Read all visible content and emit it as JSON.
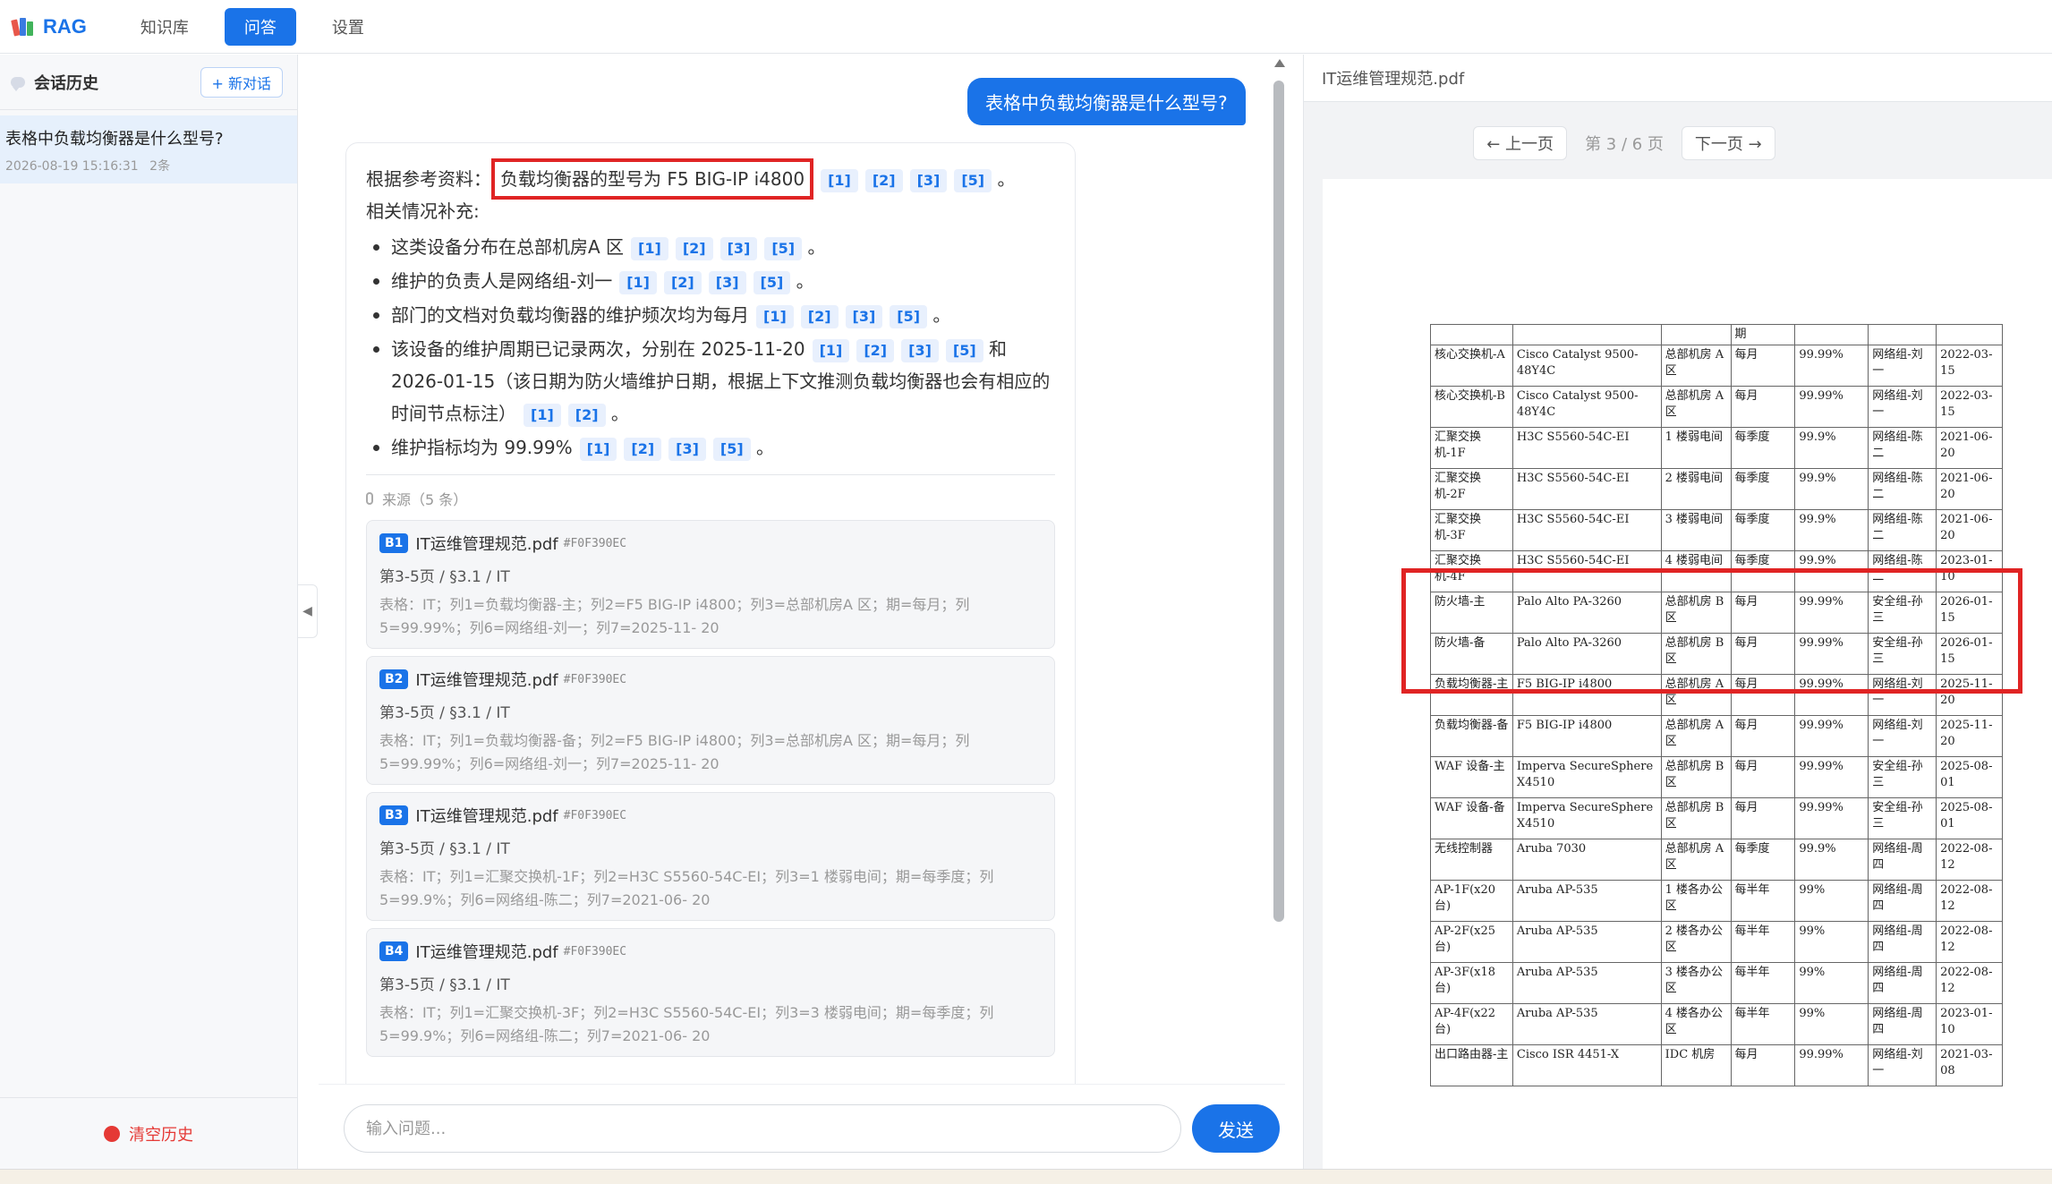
{
  "app": {
    "logo_text": "RAG",
    "nav": [
      {
        "label": "知识库",
        "active": false
      },
      {
        "label": "问答",
        "active": true
      },
      {
        "label": "设置",
        "active": false
      }
    ],
    "accent_color": "#1a73e8"
  },
  "sidebar": {
    "title": "会话历史",
    "new_chat_label": "+ 新对话",
    "sessions": [
      {
        "title": "表格中负载均衡器是什么型号?",
        "time": "2026-08-19 15:16:31",
        "count": "2条"
      }
    ],
    "clear_label": "清空历史"
  },
  "chat": {
    "user_question": "表格中负载均衡器是什么型号?",
    "answer": {
      "intro_prefix": "根据参考资料：",
      "intro_highlight": "负载均衡器的型号为 F5 BIG-IP i4800",
      "intro_cites": [
        "[1]",
        "[2]",
        "[3]",
        "[5]"
      ],
      "intro_suffix": "。",
      "supplement_label": "相关情况补充:",
      "bullets": [
        {
          "text": "这类设备分布在总部机房A 区",
          "cites": [
            "[1]",
            "[2]",
            "[3]",
            "[5]"
          ],
          "suffix": "。"
        },
        {
          "text": "维护的负责人是网络组-刘一",
          "cites": [
            "[1]",
            "[2]",
            "[3]",
            "[5]"
          ],
          "suffix": "。"
        },
        {
          "text": "部门的文档对负载均衡器的维护频次均为每月",
          "cites": [
            "[1]",
            "[2]",
            "[3]",
            "[5]"
          ],
          "suffix": "。"
        },
        {
          "text": "该设备的维护周期已记录两次，分别在 2025-11-20",
          "cites": [
            "[1]",
            "[2]",
            "[3]",
            "[5]"
          ],
          "suffix": "和 2026-01-15（该日期为防火墙维护日期，根据上下文推测负载均衡器也会有相应的时间节点标注）",
          "cites2": [
            "[1]",
            "[2]"
          ],
          "suffix2": "。"
        },
        {
          "text": "维护指标均为 99.99%",
          "cites": [
            "[1]",
            "[2]",
            "[3]",
            "[5]"
          ],
          "suffix": "。"
        }
      ]
    },
    "sources_label": "来源（5 条）",
    "sources": [
      {
        "badge": "B1",
        "file": "IT运维管理规范.pdf",
        "hash": "#F0F390EC",
        "loc": "第3-5页 / §3.1 / IT",
        "text": "表格：IT；列1=负载均衡器-主；列2=F5 BIG-IP i4800；列3=总部机房A 区；期=每月；列5=99.99%；列6=网络组-刘一；列7=2025-11- 20"
      },
      {
        "badge": "B2",
        "file": "IT运维管理规范.pdf",
        "hash": "#F0F390EC",
        "loc": "第3-5页 / §3.1 / IT",
        "text": "表格：IT；列1=负载均衡器-备；列2=F5 BIG-IP i4800；列3=总部机房A 区；期=每月；列5=99.99%；列6=网络组-刘一；列7=2025-11- 20"
      },
      {
        "badge": "B3",
        "file": "IT运维管理规范.pdf",
        "hash": "#F0F390EC",
        "loc": "第3-5页 / §3.1 / IT",
        "text": "表格：IT；列1=汇聚交换机-1F；列2=H3C S5560-54C-EI；列3=1 楼弱电间；期=每季度；列5=99.9%；列6=网络组-陈二；列7=2021-06- 20"
      },
      {
        "badge": "B4",
        "file": "IT运维管理规范.pdf",
        "hash": "#F0F390EC",
        "loc": "第3-5页 / §3.1 / IT",
        "text": "表格：IT；列1=汇聚交换机-3F；列2=H3C S5560-54C-EI；列3=3 楼弱电间；期=每季度；列5=99.9%；列6=网络组-陈二；列7=2021-06- 20"
      }
    ],
    "input_placeholder": "输入问题...",
    "send_label": "发送"
  },
  "viewer": {
    "filename": "IT运维管理规范.pdf",
    "prev_label": "← 上一页",
    "page_info": "第 3 / 6 页",
    "next_label": "下一页 →",
    "table_head": [
      "",
      "",
      "",
      "期",
      "",
      "",
      ""
    ],
    "table_rows": [
      [
        "核心交换机-A",
        "Cisco Catalyst 9500-48Y4C",
        "总部机房 A 区",
        "每月",
        "99.99%",
        "网络组-刘一",
        "2022-03-15"
      ],
      [
        "核心交换机-B",
        "Cisco Catalyst 9500-48Y4C",
        "总部机房 A 区",
        "每月",
        "99.99%",
        "网络组-刘一",
        "2022-03-15"
      ],
      [
        "汇聚交换机-1F",
        "H3C S5560-54C-EI",
        "1 楼弱电间",
        "每季度",
        "99.9%",
        "网络组-陈二",
        "2021-06-20"
      ],
      [
        "汇聚交换机-2F",
        "H3C S5560-54C-EI",
        "2 楼弱电间",
        "每季度",
        "99.9%",
        "网络组-陈二",
        "2021-06-20"
      ],
      [
        "汇聚交换机-3F",
        "H3C S5560-54C-EI",
        "3 楼弱电间",
        "每季度",
        "99.9%",
        "网络组-陈二",
        "2021-06-20"
      ],
      [
        "汇聚交换机-4F",
        "H3C S5560-54C-EI",
        "4 楼弱电间",
        "每季度",
        "99.9%",
        "网络组-陈二",
        "2023-01-10"
      ],
      [
        "防火墙-主",
        "Palo Alto PA-3260",
        "总部机房 B 区",
        "每月",
        "99.99%",
        "安全组-孙三",
        "2026-01-15"
      ],
      [
        "防火墙-备",
        "Palo Alto PA-3260",
        "总部机房 B 区",
        "每月",
        "99.99%",
        "安全组-孙三",
        "2026-01-15"
      ],
      [
        "负载均衡器-主",
        "F5 BIG-IP i4800",
        "总部机房 A 区",
        "每月",
        "99.99%",
        "网络组-刘一",
        "2025-11-20"
      ],
      [
        "负载均衡器-备",
        "F5 BIG-IP i4800",
        "总部机房 A 区",
        "每月",
        "99.99%",
        "网络组-刘一",
        "2025-11-20"
      ],
      [
        "WAF 设备-主",
        "Imperva SecureSphere X4510",
        "总部机房 B 区",
        "每月",
        "99.99%",
        "安全组-孙三",
        "2025-08-01"
      ],
      [
        "WAF 设备-备",
        "Imperva SecureSphere X4510",
        "总部机房 B 区",
        "每月",
        "99.99%",
        "安全组-孙三",
        "2025-08-01"
      ],
      [
        "无线控制器",
        "Aruba 7030",
        "总部机房 A 区",
        "每季度",
        "99.9%",
        "网络组-周四",
        "2022-08-12"
      ],
      [
        "AP-1F(x20台)",
        "Aruba AP-535",
        "1 楼各办公区",
        "每半年",
        "99%",
        "网络组-周四",
        "2022-08-12"
      ],
      [
        "AP-2F(x25台)",
        "Aruba AP-535",
        "2 楼各办公区",
        "每半年",
        "99%",
        "网络组-周四",
        "2022-08-12"
      ],
      [
        "AP-3F(x18台)",
        "Aruba AP-535",
        "3 楼各办公区",
        "每半年",
        "99%",
        "网络组-周四",
        "2022-08-12"
      ],
      [
        "AP-4F(x22台)",
        "Aruba AP-535",
        "4 楼各办公区",
        "每半年",
        "99%",
        "网络组-周四",
        "2023-01-10"
      ],
      [
        "出口路由器-主",
        "Cisco ISR 4451-X",
        "IDC 机房",
        "每月",
        "99.99%",
        "网络组-刘一",
        "2021-03-08"
      ]
    ]
  }
}
